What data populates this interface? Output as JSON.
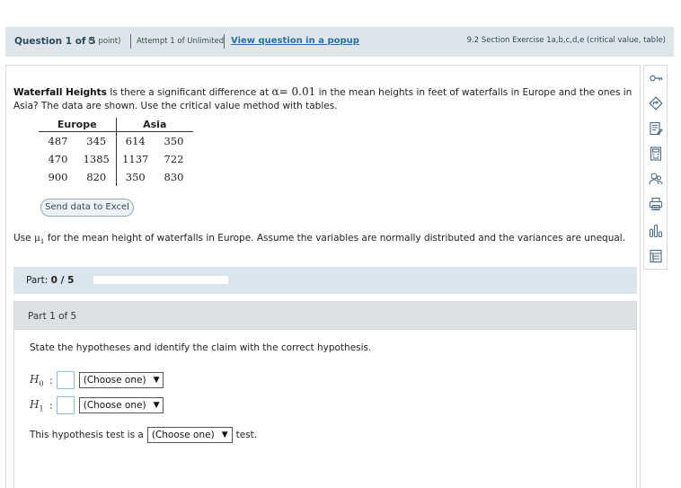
{
  "header": {
    "question_label": "Question 1 of 5",
    "points": "(1 point)",
    "attempt": "Attempt 1 of Unlimited",
    "popup_link": "View question in a popup",
    "section": "9.2 Section Exercise 1a,b,c,d,e (critical value, table)"
  },
  "problem": {
    "title": "Waterfall Heights",
    "text_1": "Is there a significant difference at",
    "alpha_symbol": "α",
    "alpha_eq": "= 0.01",
    "text_2": "in the mean heights in feet of waterfalls in Europe and the ones in Asia? The data are shown. Use the critical value method with tables."
  },
  "data_table": {
    "headers": [
      "Europe",
      "Asia"
    ],
    "rows": [
      [
        "487",
        "345",
        "614",
        "350"
      ],
      [
        "470",
        "1385",
        "1137",
        "722"
      ],
      [
        "900",
        "820",
        "350",
        "830"
      ]
    ]
  },
  "excel_button": "Send data to Excel",
  "mu_note": {
    "before": "Use",
    "symbol": "μ",
    "sub": "1",
    "after": "for the mean height of waterfalls in Europe. Assume the variables are normally distributed and the variances are unequal."
  },
  "part_progress": {
    "label": "Part:",
    "value": "0 / 5",
    "fraction": 0.0
  },
  "part1": {
    "title": "Part 1 of 5",
    "instruction": "State the hypotheses and identify the claim with the correct hypothesis.",
    "h0_symbol": "H",
    "h0_sub": "0",
    "h1_symbol": "H",
    "h1_sub": "1",
    "colon": ":",
    "select_h0": "(Choose one)",
    "select_h1": "(Choose one)",
    "test_before": "This hypothesis test is a",
    "test_select": "(Choose one)",
    "test_after": "test.",
    "arrow": "▼"
  },
  "toolbar_icons": [
    "key-icon",
    "navigate-icon",
    "notes-icon",
    "calculator-icon",
    "people-icon",
    "print-icon",
    "chart-icon",
    "table-icon"
  ]
}
